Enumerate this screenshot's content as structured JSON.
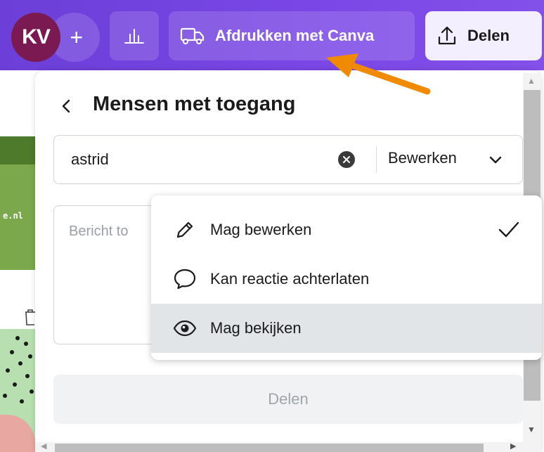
{
  "topbar": {
    "avatar_initials": "KV",
    "add_label": "+",
    "print_label": "Afdrukken met Canva",
    "share_label": "Delen"
  },
  "background": {
    "url_fragment": "e.nl"
  },
  "panel": {
    "title": "Mensen met toegang",
    "person_value": "astrid",
    "permission_selected": "Bewerken",
    "message_placeholder": "Bericht to",
    "share_button": "Delen"
  },
  "dropdown": {
    "items": [
      {
        "label": "Mag bewerken",
        "icon": "pencil-icon",
        "checked": true
      },
      {
        "label": "Kan reactie achterlaten",
        "icon": "comment-bubble-icon",
        "checked": false
      },
      {
        "label": "Mag bekijken",
        "icon": "eye-icon",
        "checked": false
      }
    ]
  },
  "colors": {
    "topbar_start": "#6b3fd8",
    "topbar_end": "#8350ea",
    "avatar": "#7b1a52",
    "arrow": "#f08a00",
    "hover_row": "#e2e5e8"
  }
}
